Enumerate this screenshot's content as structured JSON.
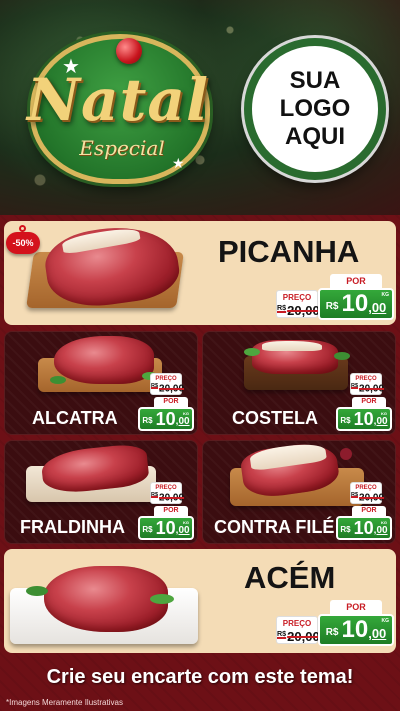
{
  "header": {
    "natal_logo": {
      "title": "Natal",
      "subtitle": "Especial"
    },
    "store_logo": {
      "line1": "SUA",
      "line2": "LOGO",
      "line3": "AQUI"
    }
  },
  "discount_badge": "-50%",
  "price_labels": {
    "preco": "PREÇO",
    "por": "POR",
    "currency": "R$",
    "unit": "KG"
  },
  "products": {
    "picanha": {
      "name": "PICANHA",
      "old_price": "20,00",
      "new_int": "10",
      "new_dec": ",00"
    },
    "alcatra": {
      "name": "ALCATRA",
      "old_price": "20,00",
      "new_int": "10",
      "new_dec": ",00"
    },
    "costela": {
      "name": "COSTELA",
      "old_price": "20,00",
      "new_int": "10",
      "new_dec": ",00"
    },
    "fraldinha": {
      "name": "FRALDINHA",
      "old_price": "20,00",
      "new_int": "10",
      "new_dec": ",00"
    },
    "contra_file": {
      "name": "CONTRA FILÉ",
      "old_price": "20,00",
      "new_int": "10",
      "new_dec": ",00"
    },
    "acem": {
      "name": "ACÉM",
      "old_price": "20,00",
      "new_int": "10",
      "new_dec": ",00"
    }
  },
  "old_price_prefix": "R$",
  "cta": "Crie seu encarte com este tema!",
  "disclaimer": "*Imagens Meramente Ilustrativas",
  "colors": {
    "background": "#6d1016",
    "cream": "#f4dcb6",
    "price_green": "#2a9530",
    "accent_red": "#c81c24"
  }
}
